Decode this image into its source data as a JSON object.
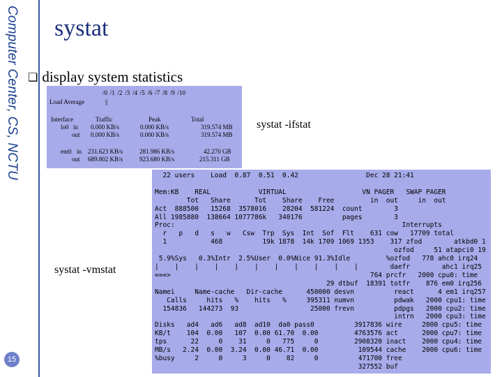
{
  "slide": {
    "vertical_title": "Computer Center, CS, NCTU",
    "title": "systat",
    "bullet": "display system statistics",
    "page_number": "15",
    "label_ifstat": "systat -ifstat",
    "label_vmstat": "systat -vmstat"
  },
  "ifstat": {
    "scale": "/0   /1   /2   /3   /4   /5   /6   /7   /8   /9   /10",
    "load_label": "Load Average",
    "load_bar": "||",
    "hdr_iface": "Interface",
    "hdr_traffic": "Traffic",
    "hdr_peak": "Peak",
    "hdr_total": "Total",
    "rows": [
      {
        "iface": "lo0",
        "dir": "in",
        "traffic": "0.000 KB/s",
        "peak": "0.000 KB/s",
        "total": "319.574 MB"
      },
      {
        "iface": "",
        "dir": "out",
        "traffic": "0.000 KB/s",
        "peak": "0.000 KB/s",
        "total": "319.574 MB"
      },
      {
        "iface": "em0",
        "dir": "in",
        "traffic": "231.623 KB/s",
        "peak": "281.986 KB/s",
        "total": "42.270 GB"
      },
      {
        "iface": "",
        "dir": "out",
        "traffic": "689.802 KB/s",
        "peak": "923.680 KB/s",
        "total": "215.311 GB"
      }
    ]
  },
  "vmstat": {
    "lines": [
      "  22 users    Load  0.87  0.51  0.42                 Dec 28 21:41",
      "",
      "Mem:KB    REAL            VIRTUAL                   VN PAGER   SWAP PAGER",
      "        Tot   Share      Tot    Share    Free         in  out     in  out",
      "Act  888500   15268  3578016    28204  581224  count        3",
      "All 1985880  138664 1077786k   340176          pages        3",
      "Proc:                                                         Interrupts",
      "  r   p   d   s   w   Csw  Trp  Sys  Int  Sof  Flt    631 cow   17709 total",
      "  1           468          19k 1878  14k 1709 1069 1353    317 zfod        atkbd0 1",
      "                                                            ozfod     51 atapci0 19",
      " 5.9%Sys   0.3%Intr  2.5%User  0.0%Nice 91.3%Idle         %ozfod   778 ahc0 irq24",
      "|    |    |    |    |    |    |    |    |    |    |        daefr        ahc1 irq25",
      "===>                                                  764 prcfr   2000 cpu0: time",
      "                                           29 dtbuf  18391 totfr    876 em0 irq256",
      "Namei     Name-cache   Dir-cache      450000 desvn          react      4 em1 irq257",
      "   Calls     hits   %    hits   %     395311 numvn          pdwak   2000 cpu1: time",
      "  154836   144273  93                  25000 frevn          pdpgs   2000 cpu2: time",
      "                                                            intrn   2000 cpu3: time",
      "Disks   ad4   ad6   ad8  ad10  da0 pass0          3917836 wire     2000 cpu5: time",
      "KB/t    104  0.00   107  0.00 61.70  0.00         4763576 act      2000 cpu7: time",
      "tps      22     0    31     0   775     0         2908320 inact    2000 cpu4: time",
      "MB/s   2.24  0.00  3.24  0.00 46.71  0.00          109544 cache    2000 cpu6: time",
      "%busy     2     0     3     0    82     0          471700 free",
      "                                                   327552 buf"
    ]
  }
}
